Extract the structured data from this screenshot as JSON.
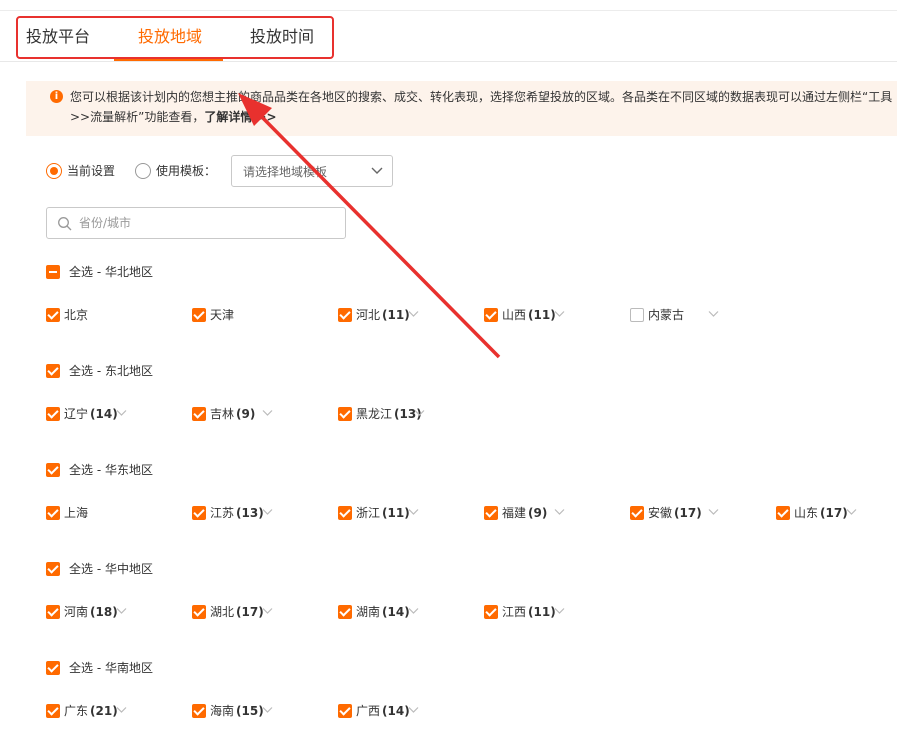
{
  "tabs": [
    {
      "label": "投放平台",
      "active": false
    },
    {
      "label": "投放地域",
      "active": true
    },
    {
      "label": "投放时间",
      "active": false
    }
  ],
  "notice": {
    "icon": "info-icon",
    "line1": "您可以根据该计划内的您想主推的商品品类在各地区的搜索、成交、转化表现，选择您希望投放的区域。各品类在不同区域的数据表现可以通过左侧栏“工具",
    "line2": ">>流量解析”功能查看，",
    "link": "了解详情 >>"
  },
  "settings": {
    "current_label": "当前设置",
    "current_checked": true,
    "template_label": "使用模板：",
    "template_checked": false,
    "template_select": "请选择地域模板"
  },
  "search": {
    "placeholder": "省份/城市",
    "value": ""
  },
  "regions": [
    {
      "title": "全选 - 华北地区",
      "state": "partial",
      "provinces": [
        {
          "name": "北京",
          "count": "",
          "checked": true,
          "expandable": false
        },
        {
          "name": "天津",
          "count": "",
          "checked": true,
          "expandable": false
        },
        {
          "name": "河北",
          "count": "(11)",
          "checked": true,
          "expandable": true
        },
        {
          "name": "山西",
          "count": "(11)",
          "checked": true,
          "expandable": true
        },
        {
          "name": "内蒙古",
          "count": "",
          "checked": false,
          "expandable": true
        }
      ]
    },
    {
      "title": "全选 - 东北地区",
      "state": "checked",
      "provinces": [
        {
          "name": "辽宁",
          "count": "(14)",
          "checked": true,
          "expandable": true
        },
        {
          "name": "吉林",
          "count": "(9)",
          "checked": true,
          "expandable": true
        },
        {
          "name": "黑龙江",
          "count": "(13)",
          "checked": true,
          "expandable": true
        }
      ]
    },
    {
      "title": "全选 - 华东地区",
      "state": "checked",
      "provinces": [
        {
          "name": "上海",
          "count": "",
          "checked": true,
          "expandable": false
        },
        {
          "name": "江苏",
          "count": "(13)",
          "checked": true,
          "expandable": true
        },
        {
          "name": "浙江",
          "count": "(11)",
          "checked": true,
          "expandable": true
        },
        {
          "name": "福建",
          "count": "(9)",
          "checked": true,
          "expandable": true
        },
        {
          "name": "安徽",
          "count": "(17)",
          "checked": true,
          "expandable": true
        },
        {
          "name": "山东",
          "count": "(17)",
          "checked": true,
          "expandable": true
        }
      ]
    },
    {
      "title": "全选 - 华中地区",
      "state": "checked",
      "provinces": [
        {
          "name": "河南",
          "count": "(18)",
          "checked": true,
          "expandable": true
        },
        {
          "name": "湖北",
          "count": "(17)",
          "checked": true,
          "expandable": true
        },
        {
          "name": "湖南",
          "count": "(14)",
          "checked": true,
          "expandable": true
        },
        {
          "name": "江西",
          "count": "(11)",
          "checked": true,
          "expandable": true
        }
      ]
    },
    {
      "title": "全选 - 华南地区",
      "state": "checked",
      "provinces": [
        {
          "name": "广东",
          "count": "(21)",
          "checked": true,
          "expandable": true
        },
        {
          "name": "海南",
          "count": "(15)",
          "checked": true,
          "expandable": true
        },
        {
          "name": "广西",
          "count": "(14)",
          "checked": true,
          "expandable": true
        }
      ]
    }
  ],
  "colors": {
    "accent": "#ff6a00",
    "annotation": "#e8312e",
    "notice_bg": "#fdf3eb"
  }
}
